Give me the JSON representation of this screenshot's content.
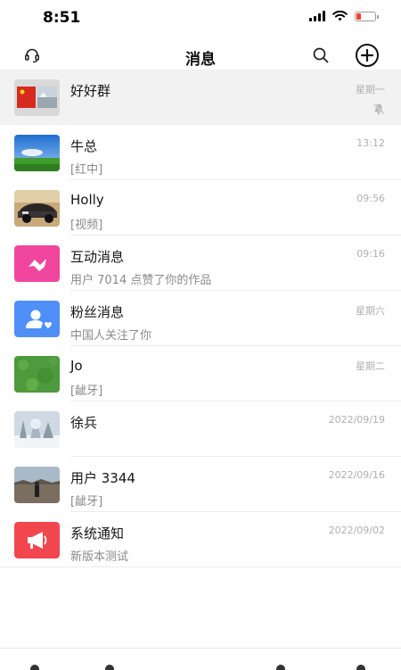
{
  "status_bar": {
    "time": "8:51",
    "battery_level": 0.2,
    "battery_color": "#ff3b30"
  },
  "nav": {
    "title": "消息",
    "left_icon": "customer-service-headset-icon",
    "search_icon": "search-icon",
    "add_icon": "plus-circle-icon"
  },
  "chats": [
    {
      "name": "好好群",
      "preview": "",
      "time": "星期一",
      "pinned": true,
      "muted": true,
      "avatar": "group-flags-photo"
    },
    {
      "name": "牛总",
      "preview": "[红中]",
      "time": "13:12",
      "avatar": "sky-field-photo"
    },
    {
      "name": "Holly",
      "preview": "[视频]",
      "time": "09:56",
      "avatar": "car-photo"
    },
    {
      "name": "互动消息",
      "preview": "用户 7014 点赞了你的作品",
      "time": "09:16",
      "avatar": "interaction-icon",
      "avatar_color": "#f0469e"
    },
    {
      "name": "粉丝消息",
      "preview": "中国人关注了你",
      "time": "星期六",
      "avatar": "fans-icon",
      "avatar_color": "#4f8ff7"
    },
    {
      "name": "Jo",
      "preview": "[龇牙]",
      "time": "星期二",
      "avatar": "grass-photo"
    },
    {
      "name": "徐兵",
      "preview": "",
      "time": "2022/09/19",
      "avatar": "snow-trees-photo"
    },
    {
      "name": "用户 3344",
      "preview": "[龇牙]",
      "time": "2022/09/16",
      "avatar": "wall-person-photo"
    },
    {
      "name": "系统通知",
      "preview": "新版本测试",
      "time": "2022/09/02",
      "avatar": "megaphone-icon",
      "avatar_color": "#f2464f"
    }
  ]
}
